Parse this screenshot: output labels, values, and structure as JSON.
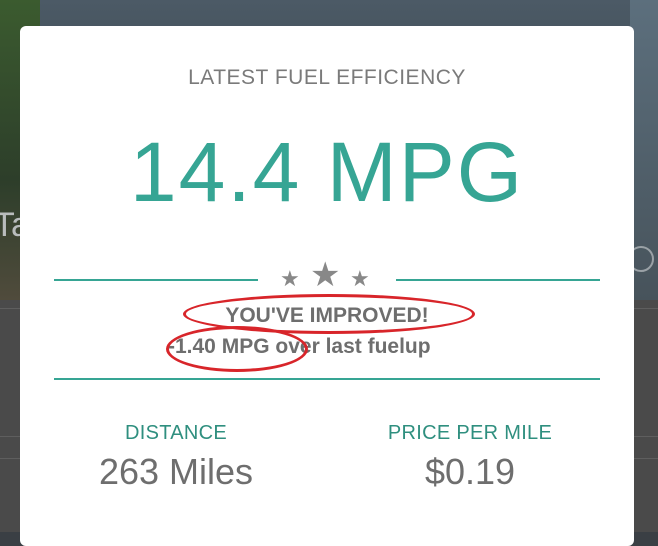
{
  "background": {
    "partial_text": "Ta"
  },
  "card": {
    "heading": "LATEST FUEL EFFICIENCY",
    "efficiency_value": "14.4 MPG",
    "improvement": {
      "title": "YOU'VE IMPROVED!",
      "delta": "-1.40 MPG",
      "suffix": " over last fuelup"
    },
    "stats": {
      "distance_label": "DISTANCE",
      "distance_value": "263 Miles",
      "price_label": "PRICE PER MILE",
      "price_value": "$0.19"
    }
  },
  "colors": {
    "accent": "#36a594",
    "annotation": "#d8252a",
    "text_gray": "#6e6e6e"
  },
  "icons": [
    "star-icon",
    "camera-icon"
  ]
}
